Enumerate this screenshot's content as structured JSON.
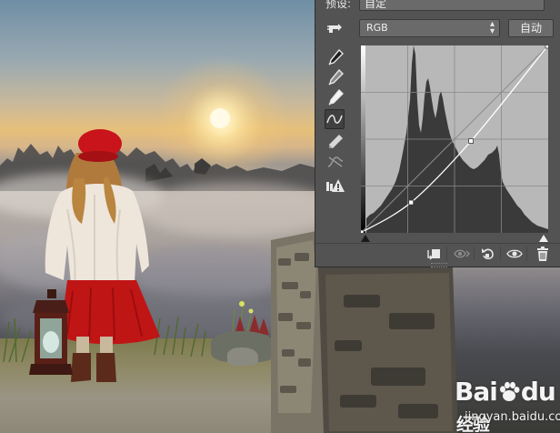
{
  "panel": {
    "preset_label": "预设:",
    "preset_value": "自定",
    "channel": "RGB",
    "auto_label": "自动"
  },
  "tools": [
    "hand-target-icon",
    "eyedropper-black-icon",
    "eyedropper-gray-icon",
    "eyedropper-white-icon",
    "curve-edit-icon",
    "pencil-icon",
    "smooth-icon",
    "clipping-warning-icon"
  ],
  "bottom_icons": [
    "clip-to-layer-icon",
    "view-previous-icon",
    "reset-icon",
    "visibility-icon",
    "delete-icon"
  ],
  "curve": {
    "points": [
      [
        0,
        0
      ],
      [
        68,
        41
      ],
      [
        150,
        125
      ],
      [
        255,
        255
      ]
    ],
    "baseline": [
      [
        0,
        0
      ],
      [
        255,
        255
      ]
    ]
  },
  "watermark": {
    "logo_bai": "Bai",
    "logo_du": "du",
    "logo_jingyan": "经验",
    "url": "jingyan.baidu.com"
  },
  "colors": {
    "panel_bg": "#535353",
    "curve": "#ffffff",
    "skirt": "#c01515",
    "hat": "#c8141a"
  }
}
